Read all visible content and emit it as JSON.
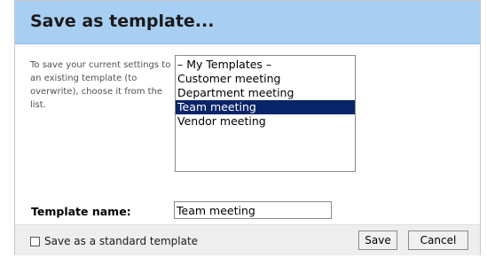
{
  "dialog": {
    "title": "Save as template...",
    "help_text": "To save your current settings to an existing template (to overwrite), choose it from the list.",
    "templates": {
      "options": [
        "– My Templates –",
        "Customer meeting",
        "Department meeting",
        "Team meeting",
        "Vendor meeting"
      ],
      "selected": "Team meeting"
    },
    "template_name": {
      "label": "Template name:",
      "value": "Team meeting"
    },
    "footer": {
      "standard_checkbox_label": "Save as a standard template",
      "standard_checked": false,
      "save_label": "Save",
      "cancel_label": "Cancel"
    }
  },
  "colors": {
    "titlebar": "#a8cff2",
    "selection": "#0a246a",
    "footer": "#eeeeee"
  }
}
